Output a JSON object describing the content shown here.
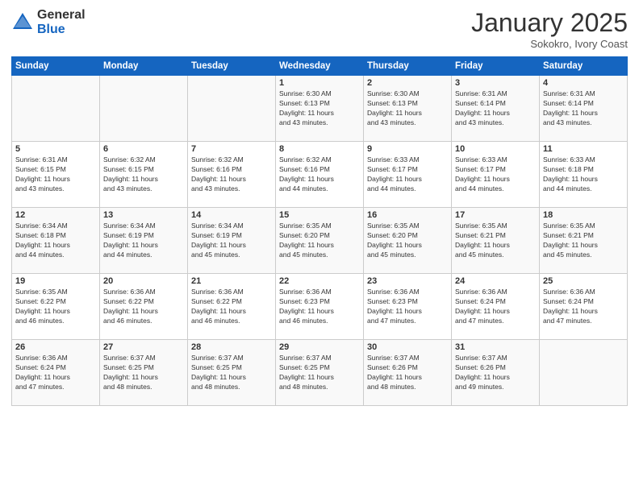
{
  "logo": {
    "general": "General",
    "blue": "Blue"
  },
  "title": "January 2025",
  "subtitle": "Sokokro, Ivory Coast",
  "days_header": [
    "Sunday",
    "Monday",
    "Tuesday",
    "Wednesday",
    "Thursday",
    "Friday",
    "Saturday"
  ],
  "weeks": [
    [
      {
        "day": "",
        "info": ""
      },
      {
        "day": "",
        "info": ""
      },
      {
        "day": "",
        "info": ""
      },
      {
        "day": "1",
        "info": "Sunrise: 6:30 AM\nSunset: 6:13 PM\nDaylight: 11 hours\nand 43 minutes."
      },
      {
        "day": "2",
        "info": "Sunrise: 6:30 AM\nSunset: 6:13 PM\nDaylight: 11 hours\nand 43 minutes."
      },
      {
        "day": "3",
        "info": "Sunrise: 6:31 AM\nSunset: 6:14 PM\nDaylight: 11 hours\nand 43 minutes."
      },
      {
        "day": "4",
        "info": "Sunrise: 6:31 AM\nSunset: 6:14 PM\nDaylight: 11 hours\nand 43 minutes."
      }
    ],
    [
      {
        "day": "5",
        "info": "Sunrise: 6:31 AM\nSunset: 6:15 PM\nDaylight: 11 hours\nand 43 minutes."
      },
      {
        "day": "6",
        "info": "Sunrise: 6:32 AM\nSunset: 6:15 PM\nDaylight: 11 hours\nand 43 minutes."
      },
      {
        "day": "7",
        "info": "Sunrise: 6:32 AM\nSunset: 6:16 PM\nDaylight: 11 hours\nand 43 minutes."
      },
      {
        "day": "8",
        "info": "Sunrise: 6:32 AM\nSunset: 6:16 PM\nDaylight: 11 hours\nand 44 minutes."
      },
      {
        "day": "9",
        "info": "Sunrise: 6:33 AM\nSunset: 6:17 PM\nDaylight: 11 hours\nand 44 minutes."
      },
      {
        "day": "10",
        "info": "Sunrise: 6:33 AM\nSunset: 6:17 PM\nDaylight: 11 hours\nand 44 minutes."
      },
      {
        "day": "11",
        "info": "Sunrise: 6:33 AM\nSunset: 6:18 PM\nDaylight: 11 hours\nand 44 minutes."
      }
    ],
    [
      {
        "day": "12",
        "info": "Sunrise: 6:34 AM\nSunset: 6:18 PM\nDaylight: 11 hours\nand 44 minutes."
      },
      {
        "day": "13",
        "info": "Sunrise: 6:34 AM\nSunset: 6:19 PM\nDaylight: 11 hours\nand 44 minutes."
      },
      {
        "day": "14",
        "info": "Sunrise: 6:34 AM\nSunset: 6:19 PM\nDaylight: 11 hours\nand 45 minutes."
      },
      {
        "day": "15",
        "info": "Sunrise: 6:35 AM\nSunset: 6:20 PM\nDaylight: 11 hours\nand 45 minutes."
      },
      {
        "day": "16",
        "info": "Sunrise: 6:35 AM\nSunset: 6:20 PM\nDaylight: 11 hours\nand 45 minutes."
      },
      {
        "day": "17",
        "info": "Sunrise: 6:35 AM\nSunset: 6:21 PM\nDaylight: 11 hours\nand 45 minutes."
      },
      {
        "day": "18",
        "info": "Sunrise: 6:35 AM\nSunset: 6:21 PM\nDaylight: 11 hours\nand 45 minutes."
      }
    ],
    [
      {
        "day": "19",
        "info": "Sunrise: 6:35 AM\nSunset: 6:22 PM\nDaylight: 11 hours\nand 46 minutes."
      },
      {
        "day": "20",
        "info": "Sunrise: 6:36 AM\nSunset: 6:22 PM\nDaylight: 11 hours\nand 46 minutes."
      },
      {
        "day": "21",
        "info": "Sunrise: 6:36 AM\nSunset: 6:22 PM\nDaylight: 11 hours\nand 46 minutes."
      },
      {
        "day": "22",
        "info": "Sunrise: 6:36 AM\nSunset: 6:23 PM\nDaylight: 11 hours\nand 46 minutes."
      },
      {
        "day": "23",
        "info": "Sunrise: 6:36 AM\nSunset: 6:23 PM\nDaylight: 11 hours\nand 47 minutes."
      },
      {
        "day": "24",
        "info": "Sunrise: 6:36 AM\nSunset: 6:24 PM\nDaylight: 11 hours\nand 47 minutes."
      },
      {
        "day": "25",
        "info": "Sunrise: 6:36 AM\nSunset: 6:24 PM\nDaylight: 11 hours\nand 47 minutes."
      }
    ],
    [
      {
        "day": "26",
        "info": "Sunrise: 6:36 AM\nSunset: 6:24 PM\nDaylight: 11 hours\nand 47 minutes."
      },
      {
        "day": "27",
        "info": "Sunrise: 6:37 AM\nSunset: 6:25 PM\nDaylight: 11 hours\nand 48 minutes."
      },
      {
        "day": "28",
        "info": "Sunrise: 6:37 AM\nSunset: 6:25 PM\nDaylight: 11 hours\nand 48 minutes."
      },
      {
        "day": "29",
        "info": "Sunrise: 6:37 AM\nSunset: 6:25 PM\nDaylight: 11 hours\nand 48 minutes."
      },
      {
        "day": "30",
        "info": "Sunrise: 6:37 AM\nSunset: 6:26 PM\nDaylight: 11 hours\nand 48 minutes."
      },
      {
        "day": "31",
        "info": "Sunrise: 6:37 AM\nSunset: 6:26 PM\nDaylight: 11 hours\nand 49 minutes."
      },
      {
        "day": "",
        "info": ""
      }
    ]
  ]
}
